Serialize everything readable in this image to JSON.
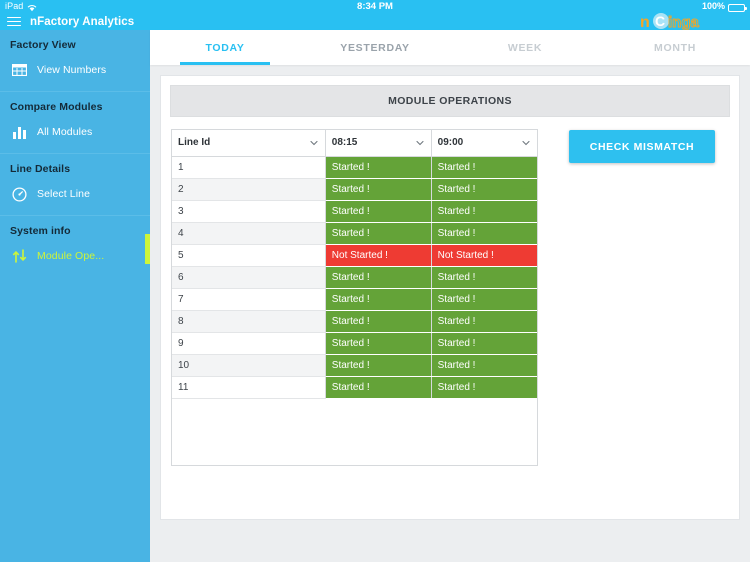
{
  "status_bar": {
    "carrier": "iPad",
    "wifi_icon": "wifi-icon",
    "time": "8:34 PM",
    "battery_percent": "100%",
    "battery_icon": "battery-full-icon"
  },
  "navbar": {
    "menu_icon": "hamburger-menu-icon",
    "app_title": "nFactory Analytics",
    "logo_text": "nCinga",
    "brand_color": "#29c0f2",
    "logo_color": "#f5a623"
  },
  "sidebar": {
    "background": "#49b4e4",
    "active_color": "#cdf53a",
    "groups": [
      {
        "heading": "Factory View",
        "items": [
          {
            "label": "View Numbers",
            "icon": "table-grid-icon",
            "active": false
          }
        ]
      },
      {
        "heading": "Compare Modules",
        "items": [
          {
            "label": "All Modules",
            "icon": "bar-chart-icon",
            "active": false
          }
        ]
      },
      {
        "heading": "Line Details",
        "items": [
          {
            "label": "Select Line",
            "icon": "compass-gauge-icon",
            "active": false
          }
        ]
      },
      {
        "heading": "System info",
        "items": [
          {
            "label": "Module Ope...",
            "icon": "up-down-arrows-icon",
            "active": true
          }
        ]
      }
    ]
  },
  "tabs": [
    {
      "label": "TODAY",
      "state": "active"
    },
    {
      "label": "YESTERDAY",
      "state": "dim"
    },
    {
      "label": "WEEK",
      "state": "inactive"
    },
    {
      "label": "MONTH",
      "state": "inactive"
    }
  ],
  "panel": {
    "title": "MODULE OPERATIONS"
  },
  "table": {
    "columns": [
      {
        "label": "Line Id",
        "dropdown": true,
        "icon": "chevron-down-icon"
      },
      {
        "label": "08:15",
        "dropdown": true,
        "icon": "chevron-down-icon"
      },
      {
        "label": "09:00",
        "dropdown": true,
        "icon": "chevron-down-icon"
      }
    ],
    "rows": [
      {
        "line_id": "1",
        "slot_0815": "Started !",
        "slot_0900": "Started !",
        "status_0815": "started",
        "status_0900": "started"
      },
      {
        "line_id": "2",
        "slot_0815": "Started !",
        "slot_0900": "Started !",
        "status_0815": "started",
        "status_0900": "started"
      },
      {
        "line_id": "3",
        "slot_0815": "Started !",
        "slot_0900": "Started !",
        "status_0815": "started",
        "status_0900": "started"
      },
      {
        "line_id": "4",
        "slot_0815": "Started !",
        "slot_0900": "Started !",
        "status_0815": "started",
        "status_0900": "started"
      },
      {
        "line_id": "5",
        "slot_0815": "Not Started !",
        "slot_0900": "Not Started !",
        "status_0815": "notstarted",
        "status_0900": "notstarted"
      },
      {
        "line_id": "6",
        "slot_0815": "Started !",
        "slot_0900": "Started !",
        "status_0815": "started",
        "status_0900": "started"
      },
      {
        "line_id": "7",
        "slot_0815": "Started !",
        "slot_0900": "Started !",
        "status_0815": "started",
        "status_0900": "started"
      },
      {
        "line_id": "8",
        "slot_0815": "Started !",
        "slot_0900": "Started !",
        "status_0815": "started",
        "status_0900": "started"
      },
      {
        "line_id": "9",
        "slot_0815": "Started !",
        "slot_0900": "Started !",
        "status_0815": "started",
        "status_0900": "started"
      },
      {
        "line_id": "10",
        "slot_0815": "Started !",
        "slot_0900": "Started !",
        "status_0815": "started",
        "status_0900": "started"
      },
      {
        "line_id": "11",
        "slot_0815": "Started !",
        "slot_0900": "Started !",
        "status_0815": "started",
        "status_0900": "started"
      }
    ],
    "status_colors": {
      "started": "#64a338",
      "notstarted": "#ee3b33"
    }
  },
  "actions": {
    "check_mismatch_label": "CHECK MISMATCH",
    "check_mismatch_color": "#2ec0ef"
  }
}
